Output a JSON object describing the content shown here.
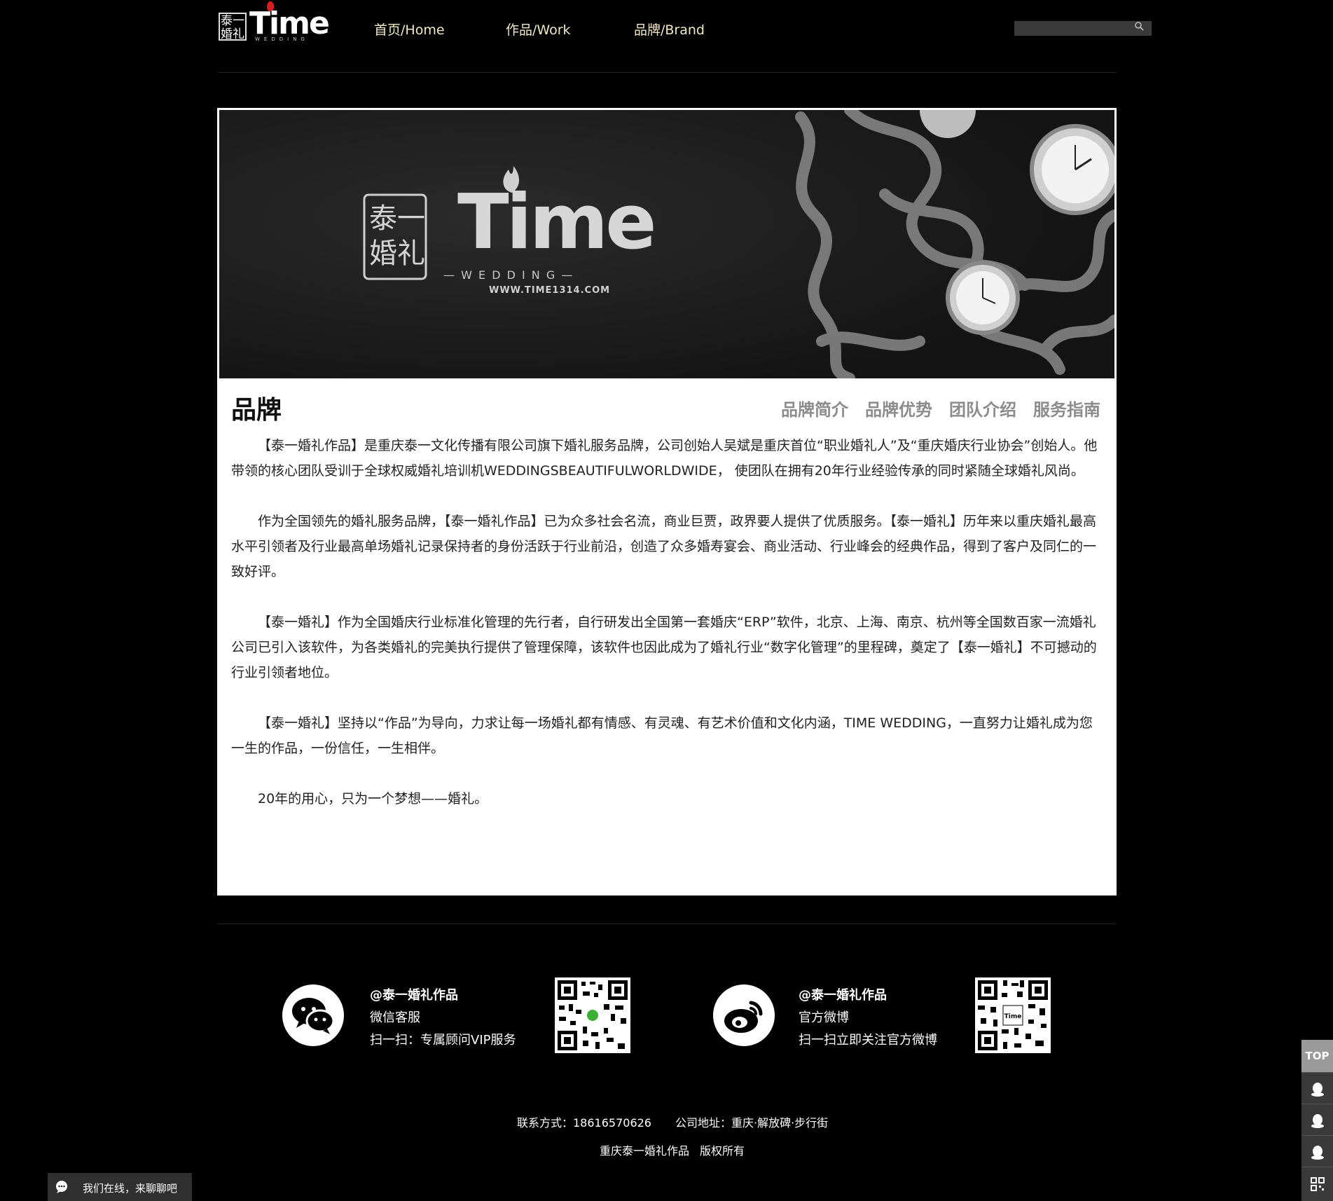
{
  "header": {
    "logo_box": "泰一婚礼",
    "logo_word": "Time",
    "logo_sub": "WEDDING",
    "nav": [
      "首页/Home",
      "作品/Work",
      "品牌/Brand"
    ],
    "search_placeholder": ""
  },
  "banner": {
    "logo_box": "泰一婚礼",
    "logo_word": "Time",
    "logo_sub": "— W E D D I N G —",
    "url": "WWW.TIME1314.COM"
  },
  "brand": {
    "title": "品牌",
    "subnav": [
      "品牌简介",
      "品牌优势",
      "团队介绍",
      "服务指南"
    ],
    "paragraphs": [
      "【泰一婚礼作品】是重庆泰一文化传播有限公司旗下婚礼服务品牌，公司创始人吴斌是重庆首位“职业婚礼人”及“重庆婚庆行业协会”创始人。他带领的核心团队受训于全球权威婚礼培训机WEDDINGSBEAUTIFULWORLDWIDE， 使团队在拥有20年行业经验传承的同时紧随全球婚礼风尚。",
      "作为全国领先的婚礼服务品牌，【泰一婚礼作品】已为众多社会名流，商业巨贾，政界要人提供了优质服务。【泰一婚礼】历年来以重庆婚礼最高水平引领者及行业最高单场婚礼记录保持者的身份活跃于行业前沿，创造了众多婚寿宴会、商业活动、行业峰会的经典作品，得到了客户及同仁的一致好评。",
      "【泰一婚礼】作为全国婚庆行业标准化管理的先行者，自行研发出全国第一套婚庆“ERP”软件，北京、上海、南京、杭州等全国数百家一流婚礼公司已引入该软件，为各类婚礼的完美执行提供了管理保障，该软件也因此成为了婚礼行业“数字化管理”的里程碑，奠定了【泰一婚礼】不可撼动的行业引领者地位。",
      "【泰一婚礼】坚持以“作品”为导向，力求让每一场婚礼都有情感、有灵魂、有艺术价值和文化内涵，TIME WEDDING，一直努力让婚礼成为您一生的作品，一份信任，一生相伴。",
      "20年的用心，只为一个梦想——婚礼。"
    ]
  },
  "footer": {
    "wechat": {
      "name": "@泰一婚礼作品",
      "line1": "微信客服",
      "line2": "扫一扫：专属顾问VIP服务"
    },
    "weibo": {
      "name": "@泰一婚礼作品",
      "line1": "官方微博",
      "line2": "扫一扫立即关注官方微博"
    },
    "contact": "联系方式：18616570626",
    "address": "公司地址：重庆·解放碑·步行街",
    "copyright_name": "重庆泰一婚礼作品",
    "copyright": "版权所有"
  },
  "side": {
    "top_label": "TOP"
  },
  "chat": {
    "label": "我们在线，来聊聊吧"
  }
}
